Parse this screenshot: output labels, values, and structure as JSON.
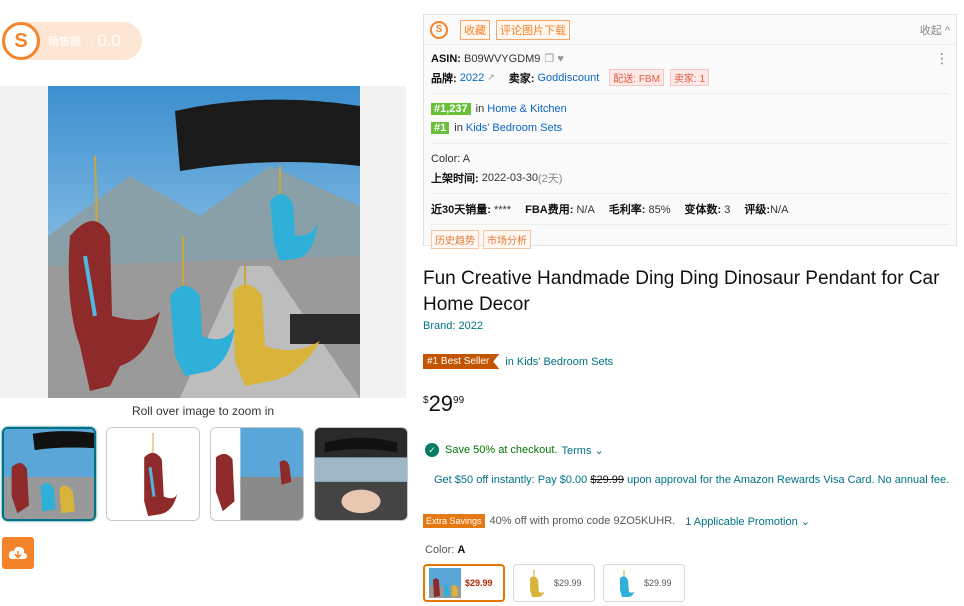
{
  "extension": {
    "badge_label": "销售额",
    "badge_value": "0.0",
    "panel_buttons": [
      "收藏",
      "评论图片下载"
    ],
    "collapse_label": "收起 ^",
    "asin_label": "ASIN:",
    "asin_value": "B09WVYGDM9",
    "brand_label": "品牌:",
    "brand_value": "2022",
    "seller_label": "卖家:",
    "seller_value": "Goddiscount",
    "shipping_tag": "配送: FBM",
    "sellers_tag": "卖家: 1",
    "rank1_value": "#1,237",
    "rank1_in": "in",
    "rank1_cat": "Home & Kitchen",
    "rank2_value": "#1",
    "rank2_in": "in",
    "rank2_cat": "Kids' Bedroom Sets",
    "color_line": "Color: A",
    "listed_label": "上架时间:",
    "listed_value": "2022-03-30",
    "listed_days": "(2天)",
    "stats": {
      "sales_label": "近30天销量:",
      "sales_value": "****",
      "fba_label": "FBA费用:",
      "fba_value": "N/A",
      "margin_label": "毛利率:",
      "margin_value": "85%",
      "variants_label": "变体数:",
      "variants_value": "3",
      "rating_label": "评级:",
      "rating_value": "N/A"
    },
    "footer_tags": [
      "历史趋势",
      "市场分析"
    ]
  },
  "gallery": {
    "zoom_hint": "Roll over image to zoom in"
  },
  "product": {
    "title": "Fun Creative Handmade Ding Ding Dinosaur Pendant for Car Home Decor",
    "brand": "Brand: 2022",
    "best_seller_badge": "#1 Best Seller",
    "best_seller_category": "in Kids' Bedroom Sets",
    "price_symbol": "$",
    "price_whole": "29",
    "price_fraction": "99",
    "save_text": "Save 50% at checkout.",
    "terms_text": "Terms ⌄",
    "card_offer_teal1": "Get $50 off instantly: Pay $0.00",
    "card_offer_strike": "$29.99",
    "card_offer_teal2": "upon approval for the Amazon Rewards Visa Card. No annual fee.",
    "extra_badge": "Extra Savings",
    "extra_text": "40% off with promo code 9ZO5KUHR.",
    "extra_promo": "1 Applicable Promotion ⌄",
    "color_label": "Color:",
    "color_value": "A",
    "swatches": [
      {
        "price": "$29.99"
      },
      {
        "price": "$29.99"
      },
      {
        "price": "$29.99"
      }
    ]
  },
  "colors": {
    "accent_orange": "#f5832a",
    "link_teal": "#007185",
    "bestseller": "#c45500",
    "save_green": "#067d62"
  }
}
